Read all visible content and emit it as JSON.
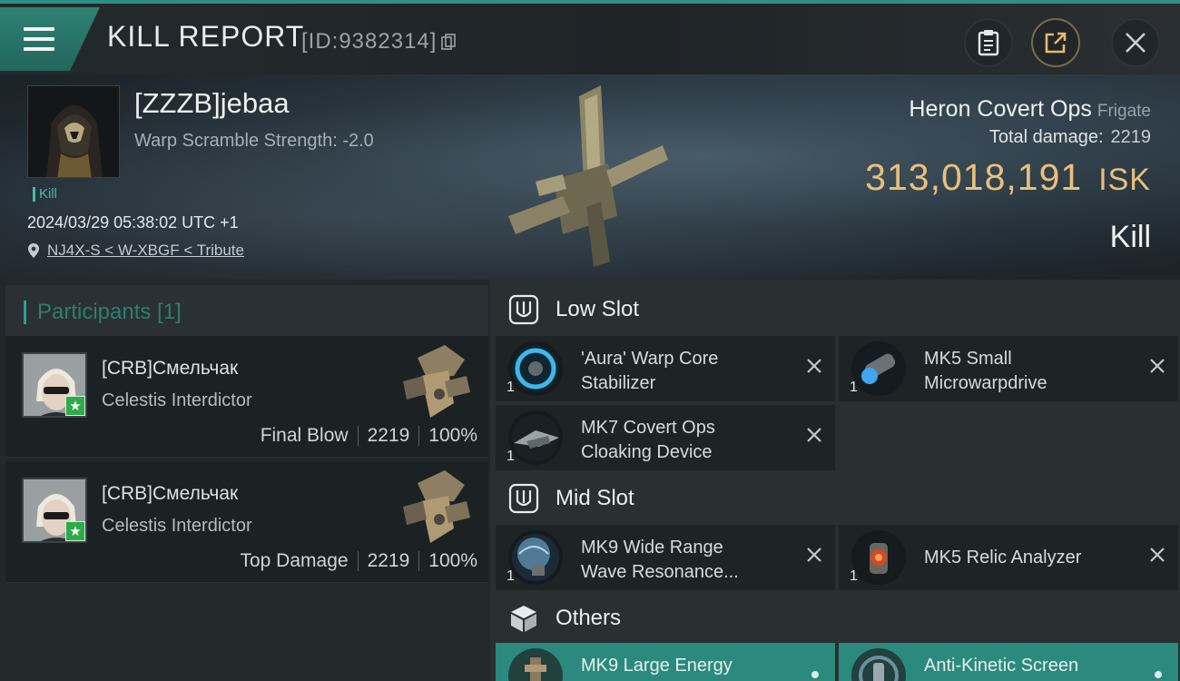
{
  "header": {
    "title": "KILL REPORT",
    "report_id": "[ID:9382314]"
  },
  "victim": {
    "name": "[ZZZB]jebaa",
    "warp_scramble": "Warp Scramble Strength: -2.0",
    "tag": "Kill",
    "datetime": "2024/03/29 05:38:02 UTC +1",
    "location": "NJ4X-S < W-XBGF < Tribute"
  },
  "ship": {
    "name": "Heron Covert Ops",
    "class": "Frigate",
    "total_damage_label": "Total damage:",
    "total_damage": "2219",
    "isk_value": "313,018,191",
    "isk_unit": "ISK",
    "result": "Kill"
  },
  "participants": {
    "title": "Participants [1]",
    "items": [
      {
        "name": "[CRB]Смельчак",
        "ship": "Celestis Interdictor",
        "role": "Final Blow",
        "damage": "2219",
        "percent": "100%"
      },
      {
        "name": "[CRB]Смельчак",
        "ship": "Celestis Interdictor",
        "role": "Top Damage",
        "damage": "2219",
        "percent": "100%"
      }
    ]
  },
  "fitting": {
    "low_slot": {
      "label": "Low Slot",
      "items": [
        {
          "qty": "1",
          "line1": "'Aura' Warp Core",
          "line2": "Stabilizer"
        },
        {
          "qty": "1",
          "line1": "MK5 Small",
          "line2": "Microwarpdrive"
        },
        {
          "qty": "1",
          "line1": "MK7 Covert Ops",
          "line2": "Cloaking Device"
        }
      ]
    },
    "mid_slot": {
      "label": "Mid Slot",
      "items": [
        {
          "qty": "1",
          "line1": "MK9 Wide Range",
          "line2": "Wave Resonance..."
        },
        {
          "qty": "1",
          "line1": "MK5 Relic Analyzer",
          "line2": ""
        }
      ]
    },
    "others": {
      "label": "Others",
      "items": [
        {
          "line1": "MK9 Large Energy"
        },
        {
          "line1": "Anti-Kinetic Screen"
        }
      ]
    }
  },
  "colors": {
    "accent_teal": "#2f8f87",
    "isk_gold": "#e8c07a",
    "badge_green": "#2eaa4a"
  },
  "icons": [
    "menu-icon",
    "copy-icon",
    "clipboard-icon",
    "share-icon",
    "close-icon",
    "location-pin-icon",
    "shield-icon",
    "cube-icon",
    "remove-icon",
    "person-icon",
    "star-icon"
  ]
}
